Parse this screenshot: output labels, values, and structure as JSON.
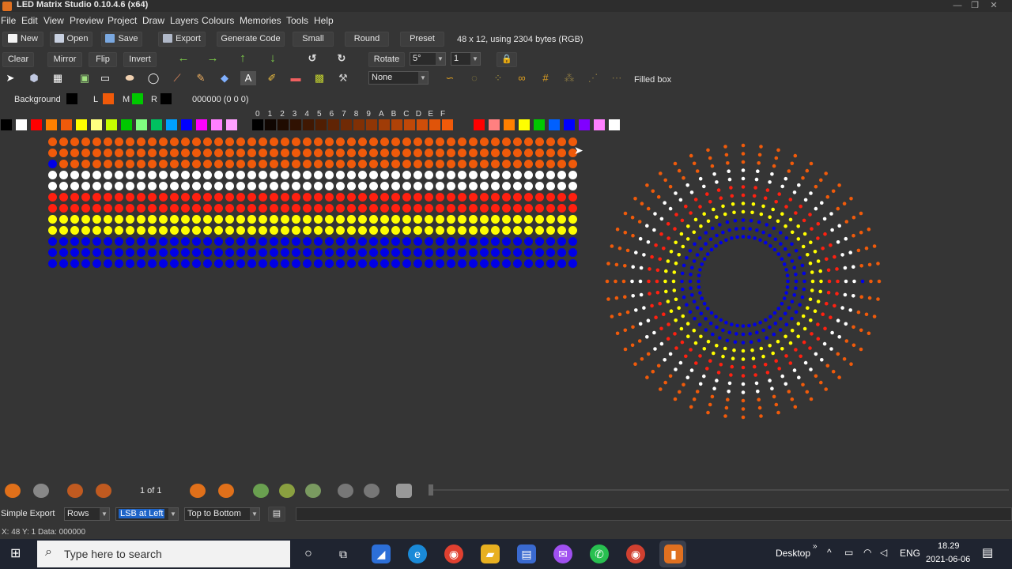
{
  "window": {
    "title": "LED Matrix Studio 0.10.4.6 (x64)",
    "min": "—",
    "max": "❐",
    "close": "✕"
  },
  "menu": [
    "File",
    "Edit",
    "View",
    "Preview",
    "Project",
    "Draw",
    "Layers",
    "Colours",
    "Memories",
    "Tools",
    "Help"
  ],
  "toolbar1": {
    "new": "New",
    "open": "Open",
    "save": "Save",
    "export": "Export",
    "generate_code": "Generate Code",
    "small": "Small",
    "round": "Round",
    "preset": "Preset",
    "info": "48 x 12, using 2304 bytes (RGB)"
  },
  "toolbar2": {
    "clear": "Clear",
    "mirror": "Mirror",
    "flip": "Flip",
    "invert": "Invert",
    "rotate": "Rotate",
    "rotate_angle": "5°",
    "rotate_count": "1"
  },
  "toolbar3": {
    "gradient_select": "None",
    "mode_label": "Filled box"
  },
  "colours": {
    "background_label": "Background",
    "background": "#000000",
    "l_label": "L",
    "l_color": "#f05a0a",
    "m_label": "M",
    "m_color": "#00c800",
    "r_label": "R",
    "r_color": "#000000",
    "readout": "000000 (0 0 0)"
  },
  "palette": [
    "#000000",
    "#ffffff",
    "#ff0000",
    "#ff8000",
    "#f05a0a",
    "#ffff00",
    "#ffff80",
    "#c8ff00",
    "#00c800",
    "#80ff80",
    "#00c060",
    "#00a0ff",
    "#0000ff",
    "#ff00ff",
    "#ff80ff",
    "#ffa0ff"
  ],
  "shade_labels": [
    "0",
    "1",
    "2",
    "3",
    "4",
    "5",
    "6",
    "7",
    "8",
    "9",
    "A",
    "B",
    "C",
    "D",
    "E",
    "F"
  ],
  "user_palette": [
    "#ff0000",
    "#ff8080",
    "#ff8000",
    "#ffff00",
    "#00c800",
    "#0060ff",
    "#0000ff",
    "#8000ff",
    "#ff80ff",
    "#ffffff"
  ],
  "matrix": {
    "rows": [
      "orange",
      "orange",
      "orange",
      "white",
      "white",
      "red",
      "red",
      "yellow",
      "yellow",
      "blue",
      "blue",
      "blue"
    ],
    "row_colors": {
      "orange": "#f05a0a",
      "white": "#ffffff",
      "red": "#ff2010",
      "yellow": "#ffff00",
      "blue": "#0000e6"
    },
    "special_pixel": {
      "row": 2,
      "col": 0,
      "color": "#0000e6"
    },
    "columns": 48
  },
  "animation": {
    "frame_label": "1 of 1"
  },
  "export": {
    "label": "Simple Export",
    "source": "Rows",
    "lsb": "LSB at Left",
    "direction": "Top to Bottom"
  },
  "status": "X: 48  Y: 1  Data: 000000",
  "taskbar": {
    "search_placeholder": "Type here to search",
    "desktop": "Desktop",
    "lang": "ENG",
    "time": "18.29",
    "date": "2021-06-06"
  }
}
